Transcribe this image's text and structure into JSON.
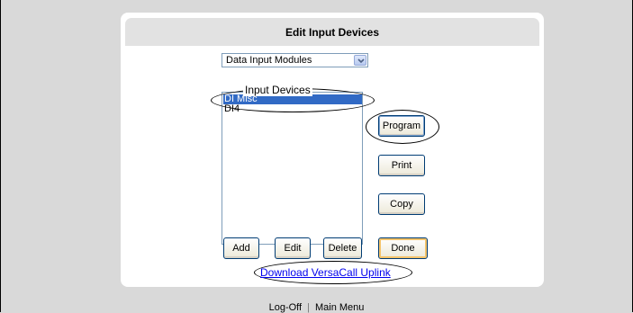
{
  "panel": {
    "title": "Edit Input Devices"
  },
  "device_type_select": {
    "selected": "Data Input Modules"
  },
  "device_list": {
    "legend": "Input Devices",
    "items": [
      {
        "label": "DI Misc",
        "selected": true
      },
      {
        "label": "DI4",
        "selected": false
      }
    ]
  },
  "side_buttons": {
    "program": "Program",
    "print": "Print",
    "copy": "Copy"
  },
  "bottom_buttons": {
    "add": "Add",
    "edit": "Edit",
    "delete": "Delete",
    "done": "Done"
  },
  "download_link": "Download VersaCall Uplink",
  "footer": {
    "logoff": "Log-Off",
    "separator": "|",
    "main_menu": "Main Menu"
  },
  "colors": {
    "selection": "#316ac5",
    "link": "#0000ee",
    "page_bg": "#d9d9d9"
  },
  "icons": {
    "select_arrow": "chevron-down-icon"
  }
}
